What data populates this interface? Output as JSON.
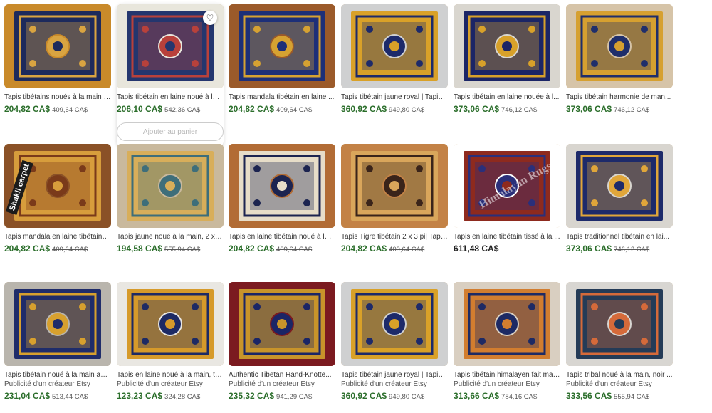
{
  "listings": [
    {
      "title": "Tapis tibétains noués à la main | ...",
      "price": "204,82 CA$",
      "old_price": "409,64 CA$",
      "sponsor": "",
      "colors": [
        "#c98a2a",
        "#1d2a5c",
        "#d9a441"
      ]
    },
    {
      "title": "Tapis tibétain en laine noué à la ...",
      "price": "206,10 CA$",
      "old_price": "542,36 CA$",
      "sponsor": "",
      "colors": [
        "#e8e6dc",
        "#24366e",
        "#b8413b"
      ]
    },
    {
      "title": "Tapis mandala tibétain en laine ...",
      "price": "204,82 CA$",
      "old_price": "409,64 CA$",
      "sponsor": "",
      "colors": [
        "#9b5a2a",
        "#1d2f78",
        "#d6a232"
      ]
    },
    {
      "title": "Tapis tibétain jaune royal | Tapis ...",
      "price": "360,92 CA$",
      "old_price": "949,80 CA$",
      "sponsor": "",
      "colors": [
        "#cfd0d1",
        "#d9a128",
        "#1d2a6a"
      ]
    },
    {
      "title": "Tapis tibétain en laine nouée à l...",
      "price": "373,06 CA$",
      "old_price": "746,12 CA$",
      "sponsor": "",
      "colors": [
        "#d9d6cf",
        "#1b2566",
        "#d8a12a"
      ]
    },
    {
      "title": "Tapis tibétain harmonie de man...",
      "price": "373,06 CA$",
      "old_price": "746,12 CA$",
      "sponsor": "",
      "colors": [
        "#d6c4a8",
        "#d6a030",
        "#1f2e6b"
      ]
    },
    {
      "title": "Tapis mandala en laine tibétaine...",
      "price": "204,82 CA$",
      "old_price": "409,64 CA$",
      "sponsor": "",
      "colors": [
        "#8a5127",
        "#d79d3c",
        "#7a3a1a"
      ]
    },
    {
      "title": "Tapis jaune noué à la main, 2 x 3...",
      "price": "194,58 CA$",
      "old_price": "555,94 CA$",
      "sponsor": "",
      "colors": [
        "#c9b99d",
        "#d8ae5a",
        "#3e6e7a"
      ]
    },
    {
      "title": "Tapis en laine tibétain noué à la ...",
      "price": "204,82 CA$",
      "old_price": "409,64 CA$",
      "sponsor": "",
      "colors": [
        "#b26c35",
        "#e7ddc8",
        "#1c2450"
      ]
    },
    {
      "title": "Tapis Tigre tibétain 2 x 3 pi| Tapi...",
      "price": "204,82 CA$",
      "old_price": "409,64 CA$",
      "sponsor": "",
      "colors": [
        "#c38246",
        "#d9a65b",
        "#3a241a"
      ]
    },
    {
      "title": "Tapis en laine tibétain tissé à la ...",
      "price": "611,48 CA$",
      "old_price": "",
      "sponsor": "",
      "colors": [
        "#ffffff",
        "#8e2a1e",
        "#2a2f7a"
      ]
    },
    {
      "title": "Tapis traditionnel tibétain en lai...",
      "price": "373,06 CA$",
      "old_price": "746,12 CA$",
      "sponsor": "",
      "colors": [
        "#d8d5cf",
        "#1d2a6a",
        "#e0a63a"
      ]
    },
    {
      "title": "Tapis tibétain noué à la main ave...",
      "price": "231,04 CA$",
      "old_price": "513,44 CA$",
      "sponsor": "Publicité d'un créateur Etsy",
      "colors": [
        "#b9b5ad",
        "#1f2c6a",
        "#d7a02e"
      ]
    },
    {
      "title": "Tapis en laine noué à la main, ta...",
      "price": "123,23 CA$",
      "old_price": "324,28 CA$",
      "sponsor": "Publicité d'un créateur Etsy",
      "colors": [
        "#e9e7e2",
        "#d69a2a",
        "#1d2a64"
      ]
    },
    {
      "title": "Authentic Tibetan Hand-Knotte...",
      "price": "235,32 CA$",
      "old_price": "941,29 CA$",
      "sponsor": "Publicité d'un créateur Etsy",
      "colors": [
        "#7b1a20",
        "#c8942a",
        "#1a2566"
      ]
    },
    {
      "title": "Tapis tibétain jaune royal | Tapis ...",
      "price": "360,92 CA$",
      "old_price": "949,80 CA$",
      "sponsor": "Publicité d'un créateur Etsy",
      "colors": [
        "#cfd0d1",
        "#d9a128",
        "#1d2a6a"
      ]
    },
    {
      "title": "Tapis tibétain himalayen fait mai...",
      "price": "313,66 CA$",
      "old_price": "784,16 CA$",
      "sponsor": "Publicité d'un créateur Etsy",
      "colors": [
        "#d9cfc1",
        "#d27d2f",
        "#1d2a64"
      ]
    },
    {
      "title": "Tapis tribal noué à la main, noir ...",
      "price": "333,56 CA$",
      "old_price": "555,94 CA$",
      "sponsor": "Publicité d'un créateur Etsy",
      "colors": [
        "#d8d6d2",
        "#243b57",
        "#d56a3a"
      ]
    }
  ],
  "hovered_index": 1,
  "add_to_cart_label": "Ajouter au panier",
  "favorite_icon": "heart-icon",
  "watermarks": {
    "shakil": "Shakil carpet",
    "himalayan": "Himalayan Rugs"
  },
  "colors": {
    "price_green": "#2b6e2b",
    "old_price_gray": "#595959"
  }
}
